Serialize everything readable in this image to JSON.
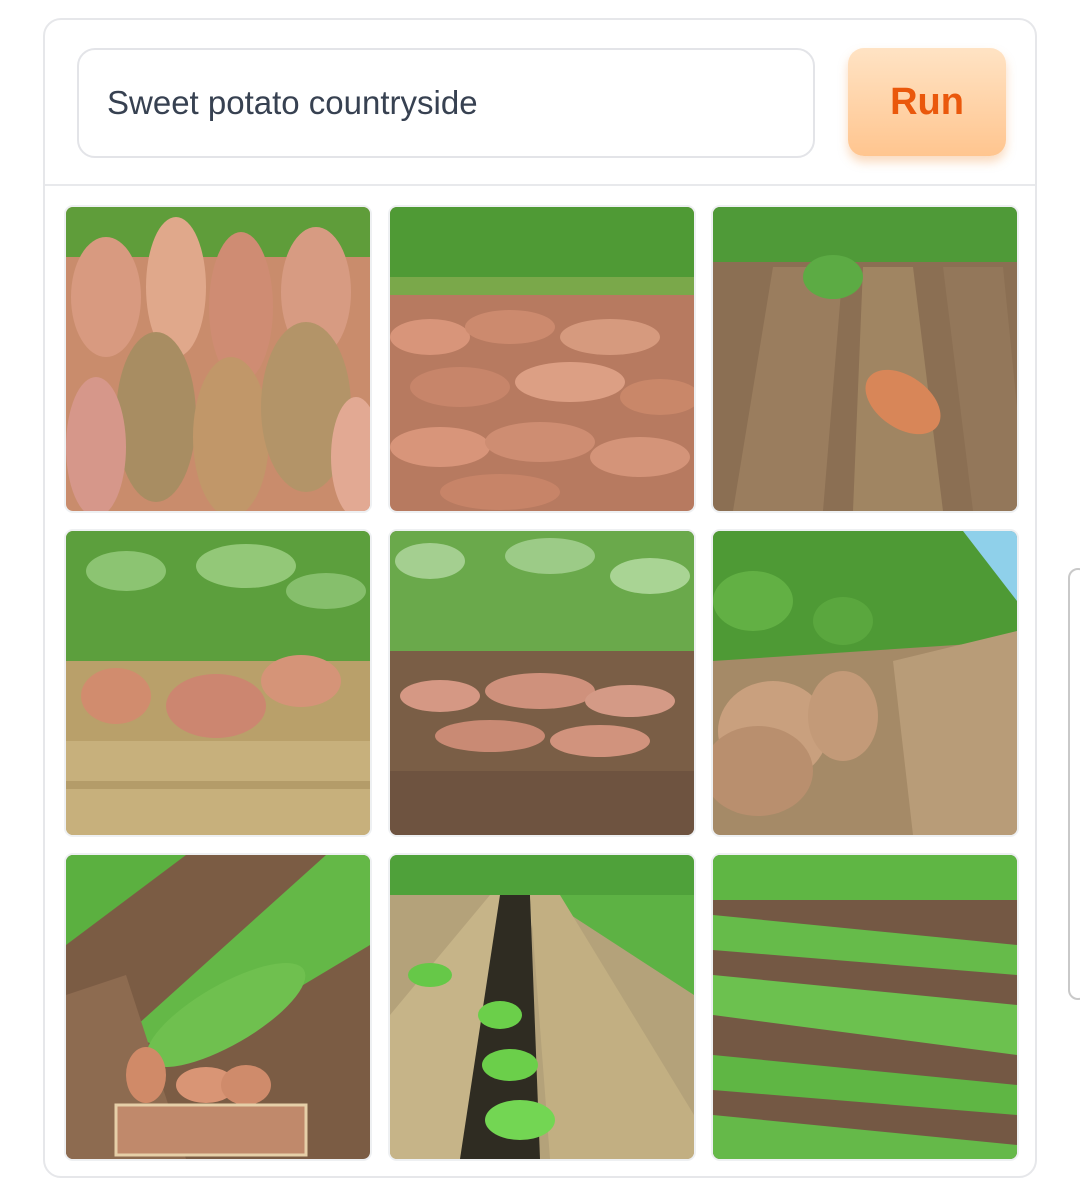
{
  "prompt": {
    "value": "Sweet potato countryside"
  },
  "run_button": {
    "label": "Run"
  },
  "gallery": {
    "item_count": 9
  },
  "colors": {
    "accent": "#ea580c",
    "button_bg": "#ffc58f",
    "border": "#e6e7ea"
  }
}
